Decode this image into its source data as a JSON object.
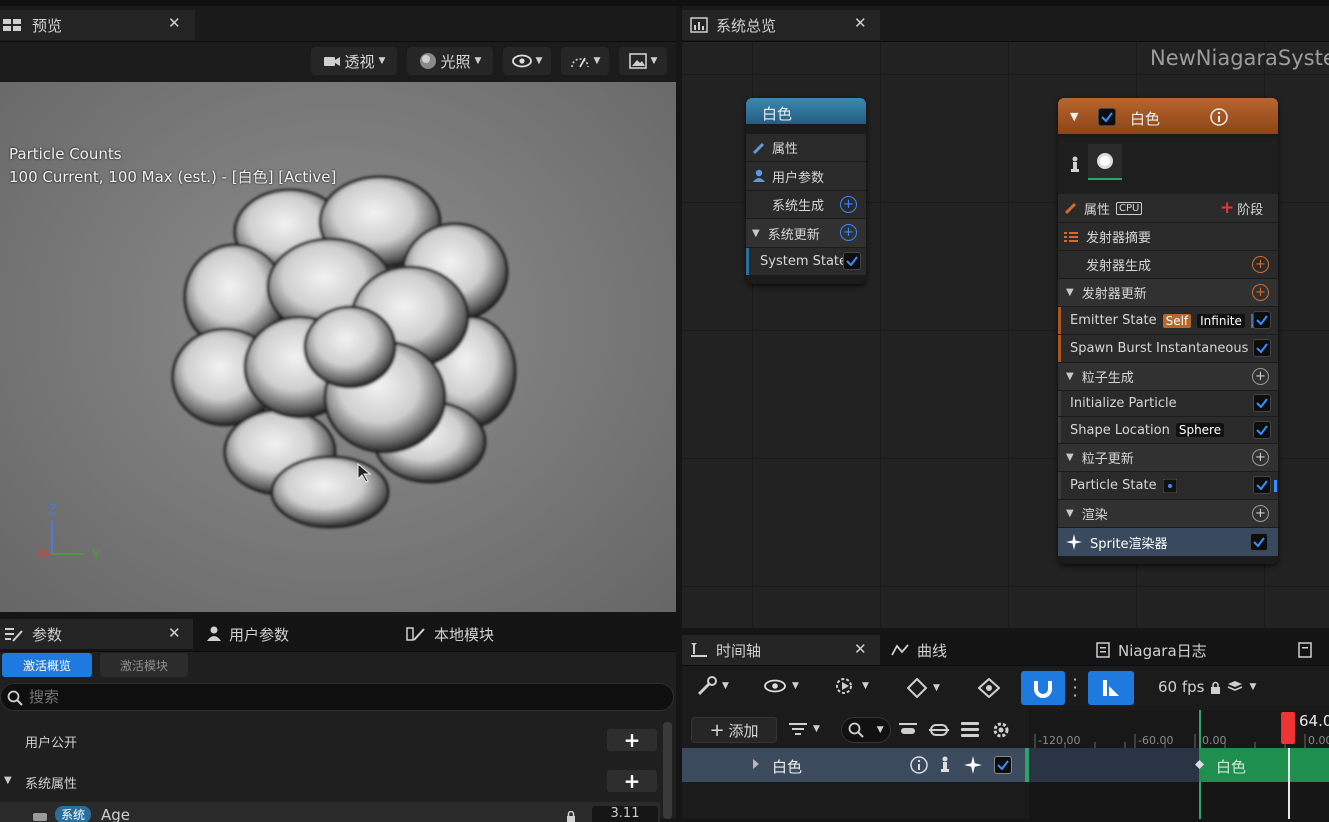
{
  "preview_panel": {
    "tab_title": "预览",
    "toolbar": {
      "perspective": "透视",
      "lighting": "光照"
    },
    "overlay": {
      "line1": "Particle Counts",
      "line2": "100 Current, 100 Max (est.) - [白色] [Active]"
    },
    "axis": {
      "z": "Z",
      "x": "X",
      "y": "Y"
    }
  },
  "system_overview": {
    "tab_title": "系统总览",
    "system_name": "NewNiagaraSyste",
    "system_node": {
      "title": "白色",
      "rows": [
        "属性",
        "用户参数",
        "系统生成",
        "系统更新",
        "System State"
      ]
    },
    "emitter_node": {
      "title": "白色",
      "properties_label": "属性",
      "cpu_label": "CPU",
      "stage_button": "阶段",
      "summary": "发射器摘要",
      "emitter_spawn": "发射器生成",
      "emitter_update": "发射器更新",
      "emitter_state": "Emitter State",
      "emitter_state_tags": [
        "Self",
        "Infinite"
      ],
      "spawn_burst": "Spawn Burst Instantaneous",
      "particle_spawn": "粒子生成",
      "initialize_particle": "Initialize Particle",
      "shape_location": "Shape Location",
      "shape_tag": "Sphere",
      "particle_update": "粒子更新",
      "particle_state": "Particle State",
      "render": "渲染",
      "sprite_renderer": "Sprite渲染器"
    },
    "colors": {
      "system_header": "#2d6f94",
      "emitter_header": "#a8551f",
      "accent_blue": "#1f7ae0",
      "timeline_green": "#1f8f4f"
    }
  },
  "params_panel": {
    "tabs": [
      "参数",
      "用户参数",
      "本地模块"
    ],
    "subtabs": [
      "激活概览",
      "激活模块"
    ],
    "search_placeholder": "搜索",
    "rows": [
      "用户公开",
      "系统属性"
    ],
    "partial_row": {
      "badge": "系统",
      "name": "Age",
      "value": "3.11"
    }
  },
  "timeline_panel": {
    "tabs": [
      "时间轴",
      "曲线",
      "Niagara日志"
    ],
    "fps": "60 fps",
    "add_button": "添加",
    "ticks": [
      "-120.00",
      "-60.00",
      "0.00",
      "0.00"
    ],
    "current_time": "64.0",
    "track_name": "白色",
    "bar_label": "白色"
  }
}
